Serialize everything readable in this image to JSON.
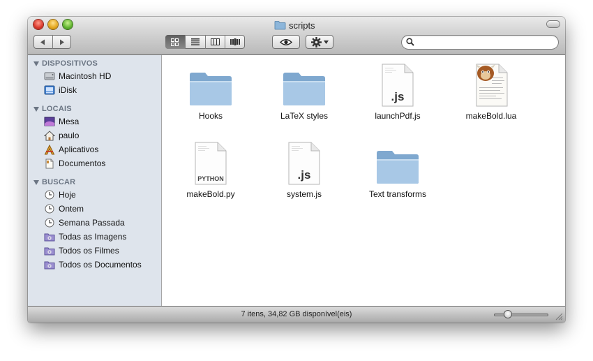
{
  "window": {
    "title": "scripts"
  },
  "toolbar": {
    "search": {
      "placeholder": "",
      "value": ""
    },
    "view_mode": "icon"
  },
  "sidebar": {
    "sections": [
      {
        "title": "DISPOSITIVOS",
        "items": [
          {
            "label": "Macintosh HD",
            "icon": "hard-drive-icon"
          },
          {
            "label": "iDisk",
            "icon": "idisk-icon"
          }
        ]
      },
      {
        "title": "LOCAIS",
        "items": [
          {
            "label": "Mesa",
            "icon": "desktop-icon"
          },
          {
            "label": "paulo",
            "icon": "home-icon"
          },
          {
            "label": "Aplicativos",
            "icon": "applications-icon"
          },
          {
            "label": "Documentos",
            "icon": "documents-icon"
          }
        ]
      },
      {
        "title": "BUSCAR",
        "items": [
          {
            "label": "Hoje",
            "icon": "clock-icon"
          },
          {
            "label": "Ontem",
            "icon": "clock-icon"
          },
          {
            "label": "Semana Passada",
            "icon": "clock-icon"
          },
          {
            "label": "Todas as Imagens",
            "icon": "smart-folder-icon"
          },
          {
            "label": "Todos os Filmes",
            "icon": "smart-folder-icon"
          },
          {
            "label": "Todos os Documentos",
            "icon": "smart-folder-icon"
          }
        ]
      }
    ]
  },
  "files": [
    {
      "name": "Hooks",
      "type": "folder"
    },
    {
      "name": "LaTeX styles",
      "type": "folder"
    },
    {
      "name": "launchPdf.js",
      "type": "document",
      "badge": ".js"
    },
    {
      "name": "makeBold.lua",
      "type": "lua-document"
    },
    {
      "name": "makeBold.py",
      "type": "document",
      "badge": "PYTHON"
    },
    {
      "name": "system.js",
      "type": "document",
      "badge": ".js"
    },
    {
      "name": "Text transforms",
      "type": "folder"
    }
  ],
  "status": {
    "text": "7 itens, 34,82 GB disponível(eis)",
    "zoom_fraction": 0.22
  }
}
